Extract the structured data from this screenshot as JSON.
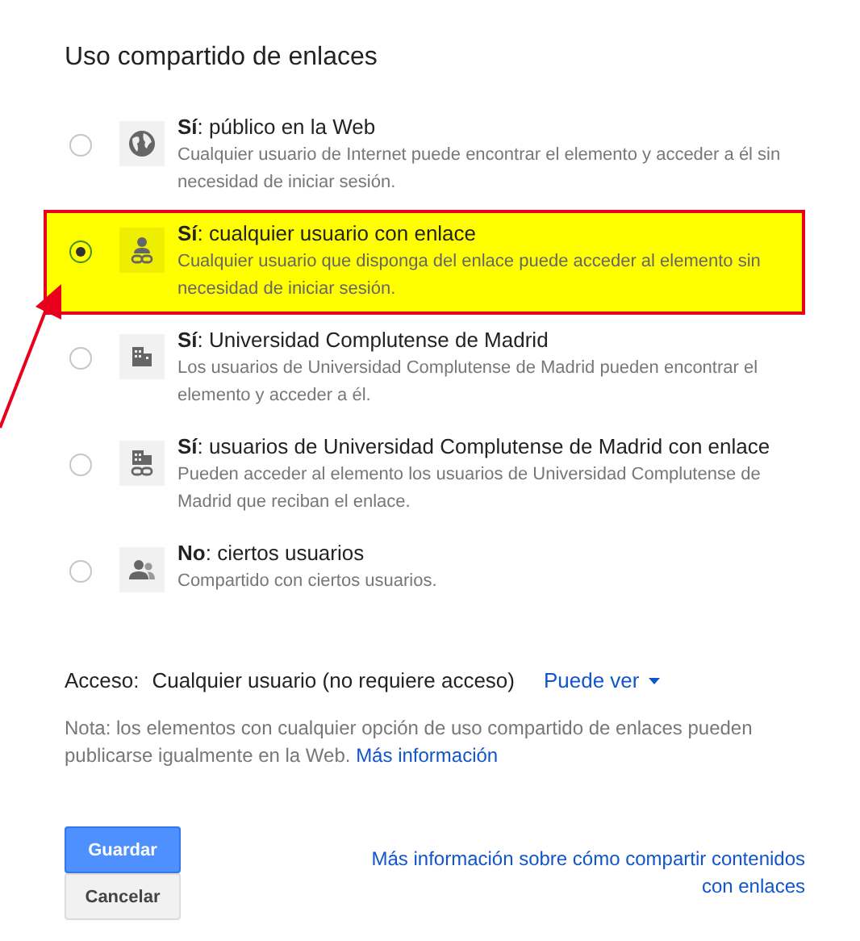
{
  "title": "Uso compartido de enlaces",
  "options": [
    {
      "kind": "globe",
      "label": "**Sí**: público en la Web",
      "description": "Cualquier usuario de Internet puede encontrar el elemento y acceder a él sin necesidad de iniciar sesión.",
      "selected": false
    },
    {
      "kind": "person-link",
      "label": "**Sí**: cualquier usuario con enlace",
      "description": "Cualquier usuario que disponga del enlace puede acceder al elemento sin necesidad de iniciar sesión.",
      "selected": true
    },
    {
      "kind": "building",
      "label": "**Sí**: Universidad Complutense de Madrid",
      "description": "Los usuarios de Universidad Complutense de Madrid pueden encontrar el elemento y acceder a él.",
      "selected": false
    },
    {
      "kind": "building-link",
      "label": "**Sí**: usuarios de Universidad Complutense de Madrid con enlace",
      "description": "Pueden acceder al elemento los usuarios de Universidad Complutense de Madrid que reciban el enlace.",
      "selected": false
    },
    {
      "kind": "people",
      "label": "**No**: ciertos usuarios",
      "description": "Compartido con ciertos usuarios.",
      "selected": false
    }
  ],
  "access": {
    "label": "Acceso:",
    "value": "Cualquier usuario (no requiere acceso)",
    "permission": "Puede ver"
  },
  "note": {
    "text": "Nota: los elementos con cualquier opción de uso compartido de enlaces pueden publicarse igualmente en la Web.",
    "link": "Más información"
  },
  "buttons": [
    {
      "label": "Guardar",
      "kind": "primary"
    },
    {
      "label": "Cancelar",
      "kind": "secondary"
    }
  ],
  "help_link": "Más información sobre cómo compartir contenidos con enlaces"
}
